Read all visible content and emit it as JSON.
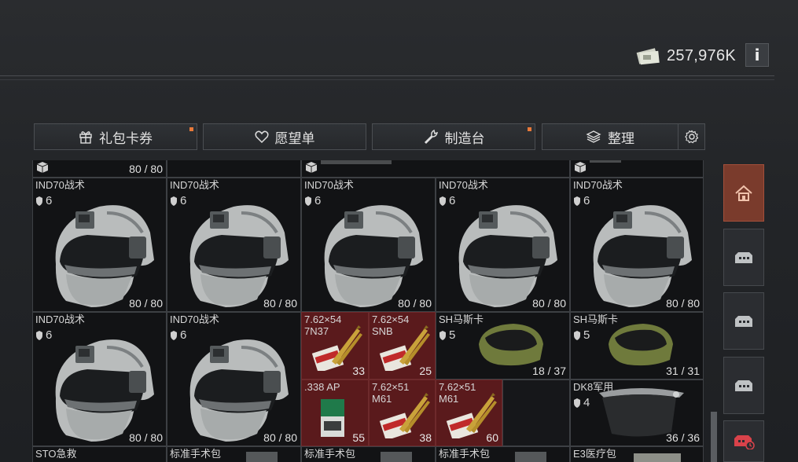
{
  "currency": {
    "icon": "cash-icon",
    "amount": "257,976K"
  },
  "info_button": {
    "label": "i"
  },
  "toolbar": {
    "gift": {
      "label": "礼包卡券",
      "icon": "gift-icon",
      "notify": true
    },
    "wishlist": {
      "label": "愿望单",
      "icon": "heart-icon",
      "notify": false
    },
    "crafting": {
      "label": "制造台",
      "icon": "wrench-icon",
      "notify": true
    },
    "organize": {
      "label": "整理",
      "icon": "layers-icon",
      "notify": false
    },
    "settings": {
      "icon": "gear-icon"
    }
  },
  "grid": {
    "top_row": [
      {
        "durability": "80 / 80"
      },
      {
        "durability": ""
      },
      {
        "durability": ""
      },
      {
        "durability": ""
      }
    ],
    "helmets_row1": [
      {
        "name": "IND70战术",
        "armor": "6",
        "durability": "80 / 80"
      },
      {
        "name": "IND70战术",
        "armor": "6",
        "durability": "80 / 80"
      },
      {
        "name": "IND70战术",
        "armor": "6",
        "durability": "80 / 80"
      },
      {
        "name": "IND70战术",
        "armor": "6",
        "durability": "80 / 80"
      },
      {
        "name": "IND70战术",
        "armor": "6",
        "durability": "80 / 80"
      }
    ],
    "helmets_row2": [
      {
        "name": "IND70战术",
        "armor": "6",
        "durability": "80 / 80"
      },
      {
        "name": "IND70战术",
        "armor": "6",
        "durability": "80 / 80"
      }
    ],
    "ammo": [
      {
        "name": "7.62×54",
        "sub": "7N37",
        "count": "33"
      },
      {
        "name": "7.62×54",
        "sub": "SNB",
        "count": "25"
      },
      {
        "name": ".338 AP",
        "sub": "",
        "count": "55"
      },
      {
        "name": "7.62×51",
        "sub": "M61",
        "count": "38"
      },
      {
        "name": "7.62×51",
        "sub": "M61",
        "count": "60"
      }
    ],
    "masks": [
      {
        "name": "SH马斯卡",
        "armor": "5",
        "durability": "18 / 37"
      },
      {
        "name": "SH马斯卡",
        "armor": "5",
        "durability": "31 / 31"
      }
    ],
    "visor": {
      "name": "DK8军用",
      "armor": "4",
      "durability": "36 / 36"
    },
    "bottom_row": [
      {
        "name": "STO急救"
      },
      {
        "name": "标准手术包"
      },
      {
        "name": "标准手术包"
      },
      {
        "name": "标准手术包"
      },
      {
        "name": "E3医疗包"
      }
    ]
  },
  "sidebar": [
    {
      "icon": "home-icon",
      "active": true
    },
    {
      "icon": "storage-box-icon",
      "active": false
    },
    {
      "icon": "storage-box-icon",
      "active": false
    },
    {
      "icon": "storage-box-icon",
      "active": false
    },
    {
      "icon": "storage-box-alert-icon",
      "active": false
    }
  ],
  "colors": {
    "accent": "#e8793a",
    "ammo_bg": "#5a1a1c",
    "sidebar_active": "#7a3b2c"
  }
}
